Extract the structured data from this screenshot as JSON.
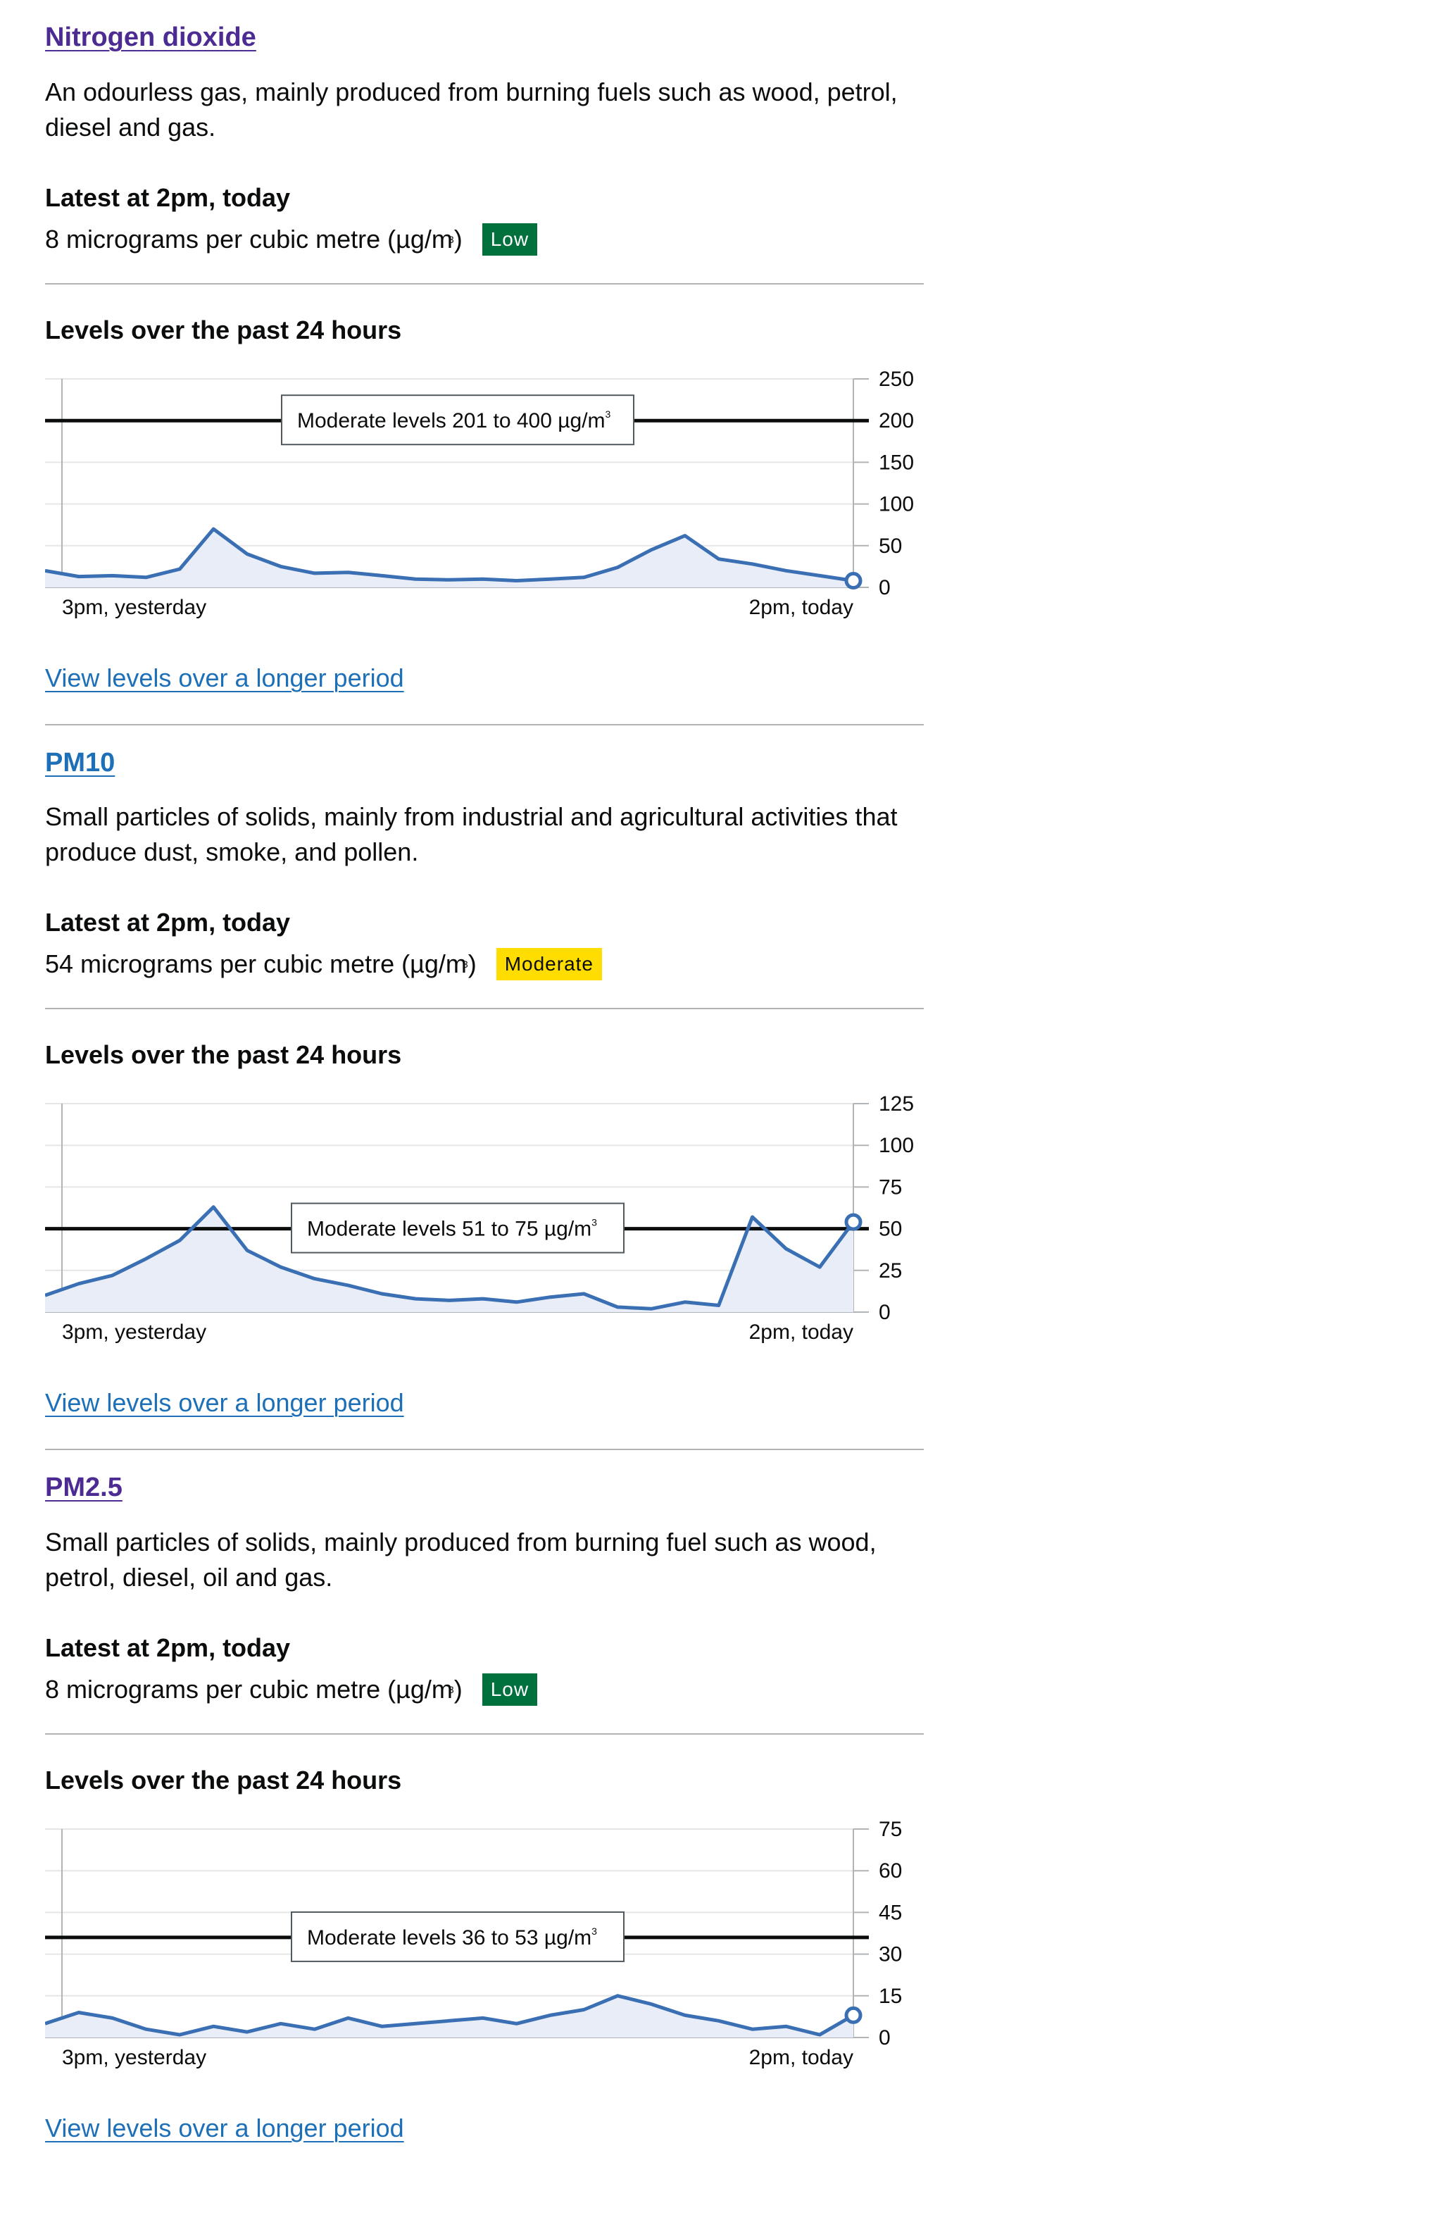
{
  "colors": {
    "link": "#1d70b8",
    "visited_link": "#4c2c92",
    "low_badge": "#00703c",
    "moderate_badge": "#ffdd00",
    "series_line": "#3a6fb4",
    "series_fill": "#e9edf7"
  },
  "pollutants": [
    {
      "title": "Nitrogen dioxide",
      "description": "An odourless gas, mainly produced from burning fuels such as wood, petrol, diesel and gas.",
      "latest_heading": "Latest at 2pm, today",
      "latest_value": "8 micrograms per cubic metre (µg/m",
      "unit_superscript": "3",
      "latest_value_suffix": ")",
      "badge": "Low",
      "chart_heading": "Levels over the past 24 hours",
      "more_link": "View levels over a longer period"
    },
    {
      "title": "PM10",
      "description": "Small particles of solids, mainly from industrial and agricultural activities that produce dust, smoke, and pollen.",
      "latest_heading": "Latest at 2pm, today",
      "latest_value": "54 micrograms per cubic metre (µg/m",
      "unit_superscript": "3",
      "latest_value_suffix": ")",
      "badge": "Moderate",
      "chart_heading": "Levels over the past 24 hours",
      "more_link": "View levels over a longer period"
    },
    {
      "title": "PM2.5",
      "description": "Small particles of solids, mainly produced from burning fuel such as wood, petrol, diesel, oil and gas.",
      "latest_heading": "Latest at 2pm, today",
      "latest_value": "8 micrograms per cubic metre (µg/m",
      "unit_superscript": "3",
      "latest_value_suffix": ")",
      "badge": "Low",
      "chart_heading": "Levels over the past 24 hours",
      "more_link": "View levels over a longer period"
    }
  ],
  "chart_data": [
    {
      "type": "area",
      "title": "Levels over the past 24 hours",
      "x_labels": [
        "3pm, yesterday",
        "2pm, today"
      ],
      "y_ticks": [
        250,
        200,
        150,
        100,
        50,
        0
      ],
      "ylim": [
        0,
        250
      ],
      "threshold": {
        "value": 200,
        "label": "Moderate levels 201 to 400 µg/m",
        "label_sup": "3"
      },
      "values": [
        20,
        13,
        14,
        12,
        22,
        70,
        40,
        25,
        17,
        18,
        14,
        10,
        9,
        10,
        8,
        10,
        12,
        24,
        45,
        62,
        34,
        28,
        20,
        14,
        8
      ],
      "grid": true
    },
    {
      "type": "area",
      "title": "Levels over the past 24 hours",
      "x_labels": [
        "3pm, yesterday",
        "2pm, today"
      ],
      "y_ticks": [
        125,
        100,
        75,
        50,
        25,
        0
      ],
      "ylim": [
        0,
        125
      ],
      "threshold": {
        "value": 50,
        "label": "Moderate levels 51 to 75 µg/m",
        "label_sup": "3"
      },
      "values": [
        10,
        17,
        22,
        32,
        43,
        63,
        37,
        27,
        20,
        16,
        11,
        8,
        7,
        8,
        6,
        9,
        11,
        3,
        2,
        6,
        4,
        57,
        38,
        27,
        54
      ],
      "grid": true
    },
    {
      "type": "area",
      "title": "Levels over the past 24 hours",
      "x_labels": [
        "3pm, yesterday",
        "2pm, today"
      ],
      "y_ticks": [
        75,
        60,
        45,
        30,
        15,
        0
      ],
      "ylim": [
        0,
        75
      ],
      "threshold": {
        "value": 36,
        "label": "Moderate levels 36 to 53 µg/m",
        "label_sup": "3"
      },
      "values": [
        5,
        9,
        7,
        3,
        1,
        4,
        2,
        5,
        3,
        7,
        4,
        5,
        6,
        7,
        5,
        8,
        10,
        15,
        12,
        8,
        6,
        3,
        4,
        1,
        8
      ],
      "grid": true
    }
  ]
}
